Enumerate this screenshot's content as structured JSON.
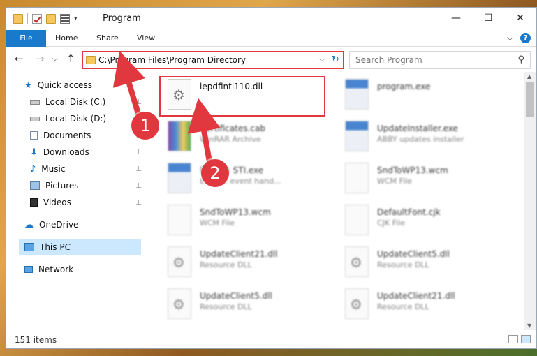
{
  "window": {
    "title": "Program",
    "caption": {
      "minimize": "—",
      "maximize": "☐",
      "close": "✕"
    }
  },
  "ribbon": {
    "tabs": [
      "File",
      "Home",
      "Share",
      "View"
    ],
    "expand": "⌵",
    "help": "?"
  },
  "nav": {
    "back": "←",
    "forward": "→",
    "recent": "⌵",
    "up": "↑",
    "address": "C:\\Program Files\\Program Directory",
    "address_dropdown": "⌵",
    "refresh": "↻",
    "search_placeholder": "Search Program",
    "search_icon": "⚲"
  },
  "sidebar": {
    "items": [
      {
        "label": "Quick access",
        "icon": "star-icon",
        "pinned": false
      },
      {
        "label": "Local Disk (C:)",
        "icon": "drive-icon",
        "pinned": true
      },
      {
        "label": "Local Disk (D:)",
        "icon": "drive-icon",
        "pinned": true
      },
      {
        "label": "Documents",
        "icon": "documents-icon",
        "pinned": true
      },
      {
        "label": "Downloads",
        "icon": "downloads-icon",
        "pinned": true
      },
      {
        "label": "Music",
        "icon": "music-icon",
        "pinned": true
      },
      {
        "label": "Pictures",
        "icon": "pictures-icon",
        "pinned": true
      },
      {
        "label": "Videos",
        "icon": "videos-icon",
        "pinned": true
      },
      {
        "label": "OneDrive",
        "icon": "onedrive-icon",
        "pinned": false
      },
      {
        "label": "This PC",
        "icon": "pc-icon",
        "pinned": false,
        "selected": true
      },
      {
        "label": "Network",
        "icon": "network-icon",
        "pinned": false
      }
    ],
    "pin_glyph": "📌"
  },
  "files": [
    {
      "name": "iepdfintl110.dll",
      "type": "",
      "icon": "dll-icon",
      "highlighted": true
    },
    {
      "name": "program.exe",
      "type": "",
      "icon": "exe-icon"
    },
    {
      "name": "Certificates.cab",
      "type": "WinRAR Archive",
      "icon": "rar-icon"
    },
    {
      "name": "UpdateInstaller.exe",
      "type": "ABBY updates installer",
      "icon": "exe-icon"
    },
    {
      "name": "Browse STI.exe",
      "type": "Browse event hand...",
      "icon": "exe-icon"
    },
    {
      "name": "SndToWP13.wcm",
      "type": "WCM File",
      "icon": "file-icon"
    },
    {
      "name": "SndToWP13.wcm",
      "type": "WCM File",
      "icon": "file-icon"
    },
    {
      "name": "DefaultFont.cjk",
      "type": "CJK File",
      "icon": "file-icon"
    },
    {
      "name": "UpdateClient21.dll",
      "type": "Resource DLL",
      "icon": "dll-icon"
    },
    {
      "name": "UpdateClient5.dll",
      "type": "Resource DLL",
      "icon": "dll-icon"
    },
    {
      "name": "UpdateClient5.dll",
      "type": "Resource DLL",
      "icon": "dll-icon"
    },
    {
      "name": "UpdateClient21.dll",
      "type": "Resource DLL",
      "icon": "dll-icon"
    }
  ],
  "status": {
    "item_count": "151 items"
  },
  "callouts": [
    "1",
    "2"
  ],
  "colors": {
    "accent": "#1979ca",
    "highlight": "#e0383e",
    "selected": "#cce8ff"
  }
}
